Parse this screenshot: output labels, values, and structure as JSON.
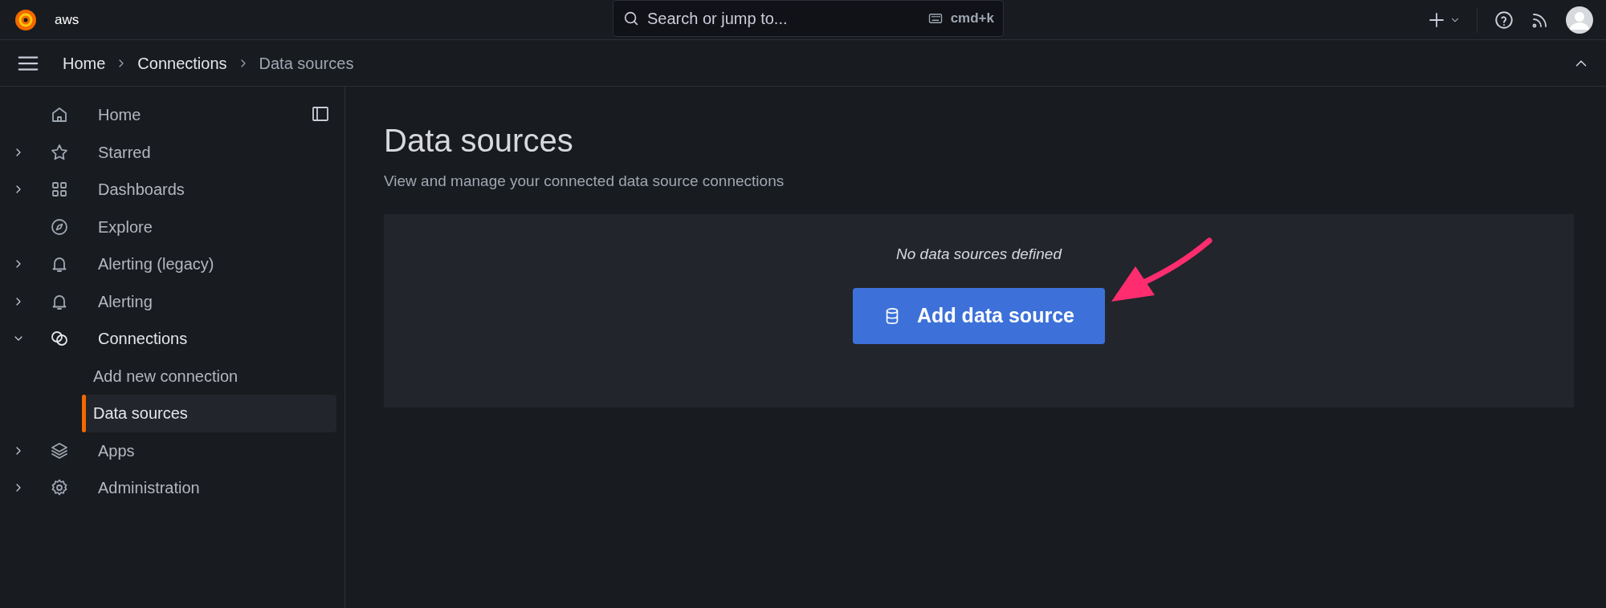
{
  "top_bar": {
    "brand": "aws",
    "search": {
      "placeholder": "Search or jump to...",
      "shortcut": "cmd+k"
    }
  },
  "breadcrumbs": [
    {
      "label": "Home",
      "current": false
    },
    {
      "label": "Connections",
      "current": false
    },
    {
      "label": "Data sources",
      "current": true
    }
  ],
  "sidebar": {
    "items": [
      {
        "label": "Home",
        "kind": "home",
        "has_children": false,
        "selected": false
      },
      {
        "label": "Starred",
        "kind": "star",
        "has_children": true,
        "expanded": false,
        "selected": false
      },
      {
        "label": "Dashboards",
        "kind": "grid",
        "has_children": true,
        "expanded": false,
        "selected": false
      },
      {
        "label": "Explore",
        "kind": "compass",
        "has_children": false,
        "selected": false
      },
      {
        "label": "Alerting (legacy)",
        "kind": "bell",
        "has_children": true,
        "expanded": false,
        "selected": false
      },
      {
        "label": "Alerting",
        "kind": "bell",
        "has_children": true,
        "expanded": false,
        "selected": false
      },
      {
        "label": "Connections",
        "kind": "link",
        "has_children": true,
        "expanded": true,
        "selected": true,
        "children": [
          {
            "label": "Add new connection",
            "selected": false
          },
          {
            "label": "Data sources",
            "selected": true
          }
        ]
      },
      {
        "label": "Apps",
        "kind": "layers",
        "has_children": true,
        "expanded": false,
        "selected": false
      },
      {
        "label": "Administration",
        "kind": "gear",
        "has_children": true,
        "expanded": false,
        "selected": false
      }
    ]
  },
  "page": {
    "title": "Data sources",
    "subtitle": "View and manage your connected data source connections",
    "empty_state": {
      "message": "No data sources defined",
      "button": "Add data source"
    }
  }
}
